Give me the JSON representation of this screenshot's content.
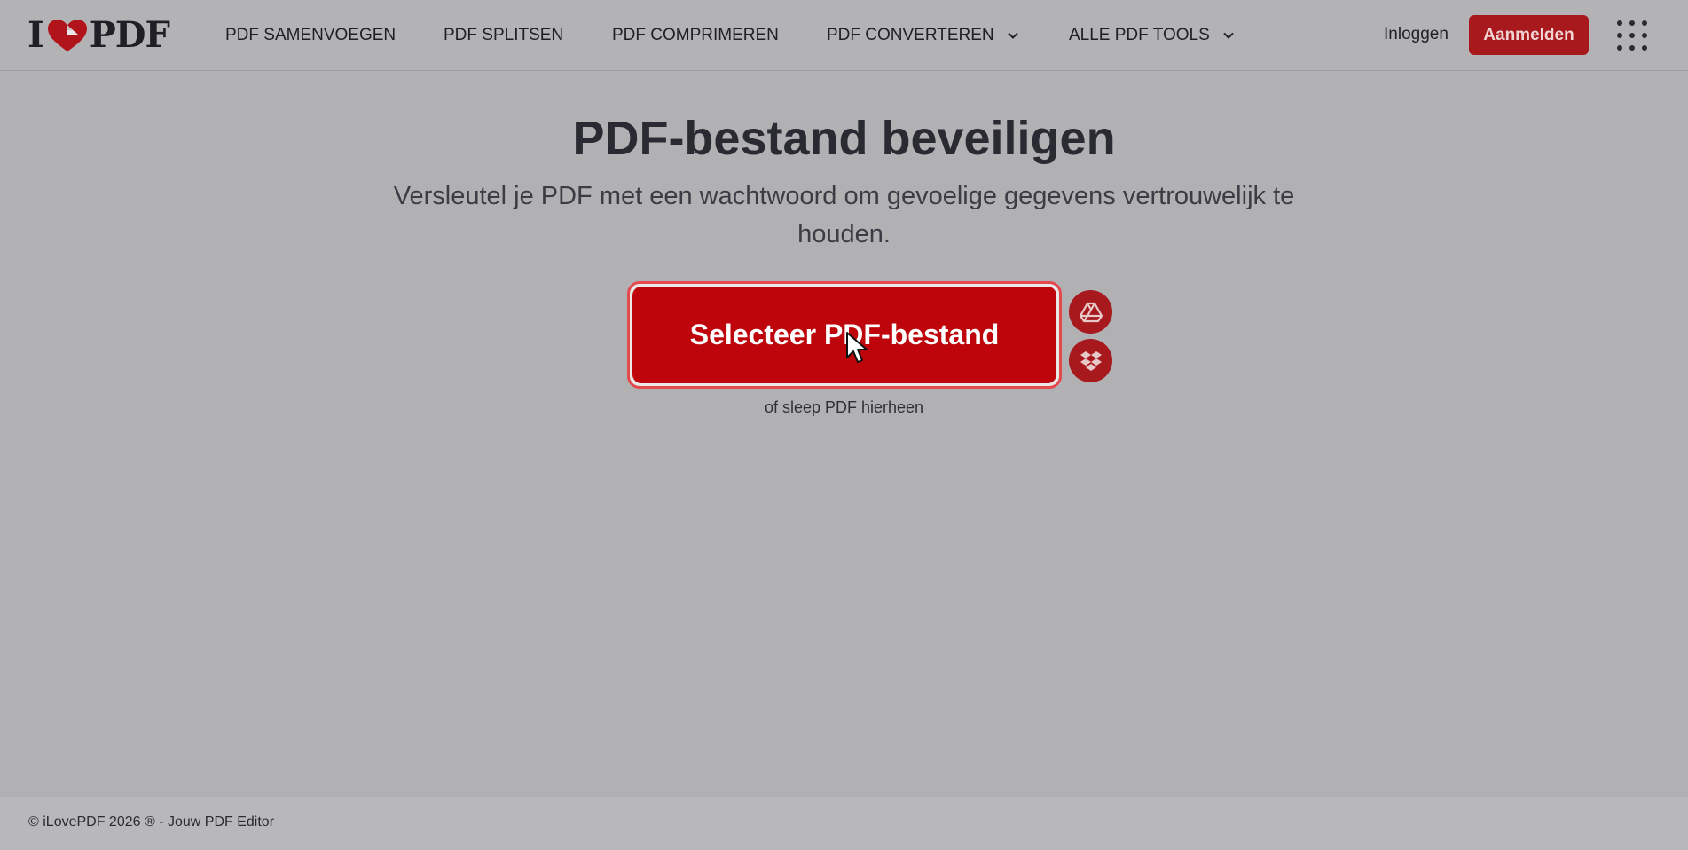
{
  "header": {
    "logo": {
      "left": "I",
      "right": "PDF"
    },
    "nav": [
      {
        "label": "PDF SAMENVOEGEN"
      },
      {
        "label": "PDF SPLITSEN"
      },
      {
        "label": "PDF COMPRIMEREN"
      },
      {
        "label": "PDF CONVERTEREN"
      },
      {
        "label": "ALLE PDF TOOLS"
      }
    ],
    "login_label": "Inloggen",
    "signup_label": "Aanmelden",
    "apps_icon": "grid-dots-icon"
  },
  "main": {
    "title": "PDF-bestand beveiligen",
    "subtitle": "Versleutel je PDF met een wachtwoord om gevoelige gegevens vertrouwelijk te houden.",
    "select_button_label": "Selecteer PDF-bestand",
    "drop_hint": "of sleep PDF hierheen",
    "cloud_buttons": [
      {
        "icon": "google-drive-icon"
      },
      {
        "icon": "dropbox-icon"
      }
    ]
  },
  "footer": {
    "copyright": "© iLovePDF 2026 ® - Jouw PDF Editor"
  },
  "colors": {
    "brand_red": "#bd050b",
    "signup_red": "#a8191e",
    "overlay_bg": "#b1b1b3",
    "text_dark": "#2a2a33"
  }
}
